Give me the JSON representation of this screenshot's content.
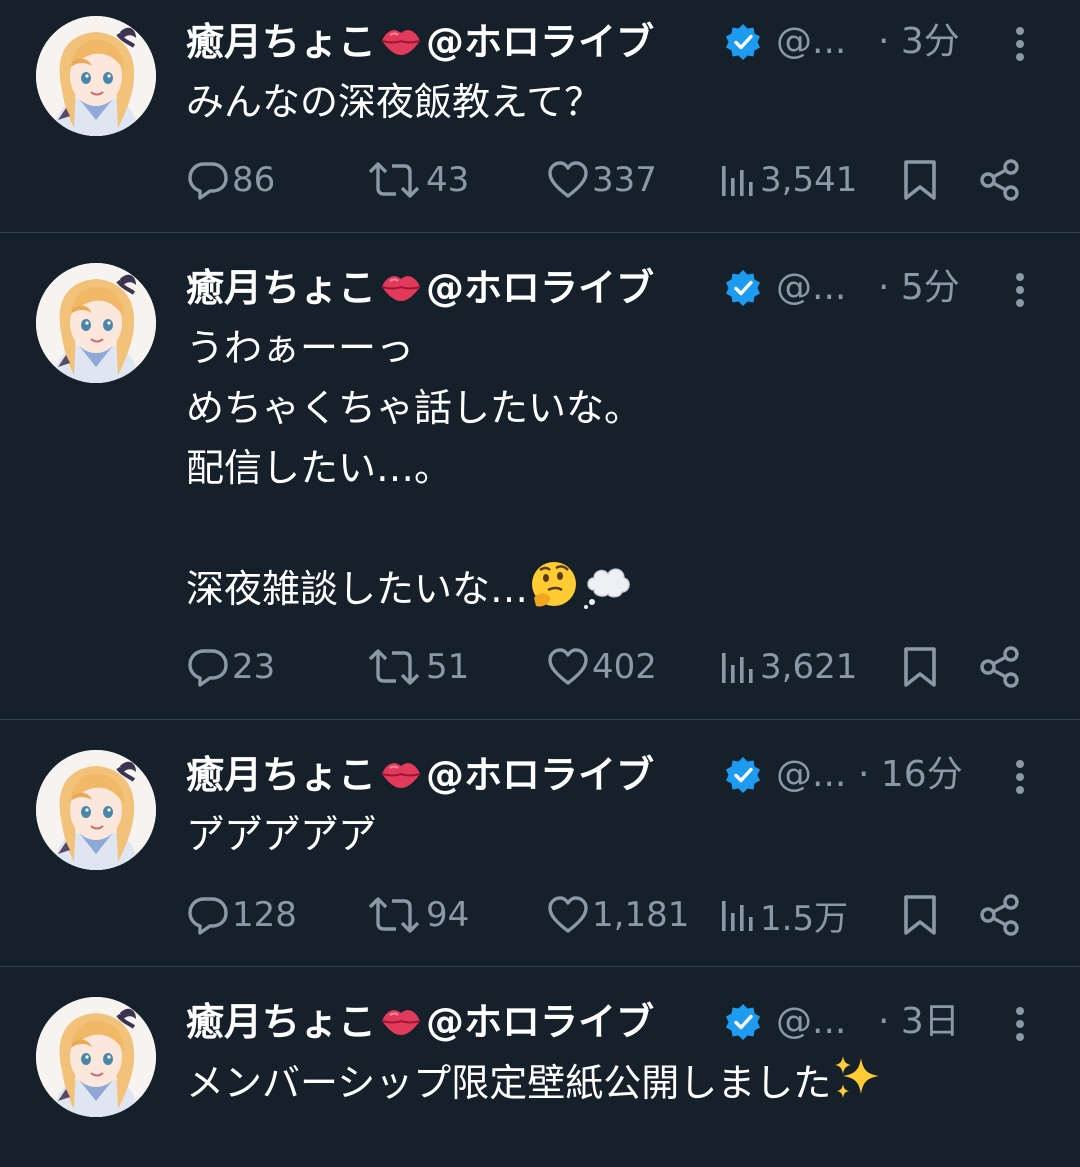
{
  "colors": {
    "background": "#15202b",
    "text": "#ffffff",
    "muted": "#8b98a5",
    "divider": "#38444d",
    "verified": "#1d9bf0"
  },
  "tweets": [
    {
      "name": "癒月ちょこ",
      "name_suffix": "@ホロライブ",
      "name_emoji": "lips-icon",
      "handle": "@...",
      "time": "· 3分",
      "text": "みんなの深夜飯教えて？",
      "emoji": [],
      "replies": "86",
      "retweets": "43",
      "likes": "337",
      "views": "3,541"
    },
    {
      "name": "癒月ちょこ",
      "name_suffix": "@ホロライブ",
      "name_emoji": "lips-icon",
      "handle": "@...",
      "time": "· 5分",
      "text": "うわぁーーっ\nめちゃくちゃ話したいな。\n配信したい…。\n\n深夜雑談したいな…",
      "emoji": [
        "thinking-face-icon",
        "thought-balloon-icon"
      ],
      "replies": "23",
      "retweets": "51",
      "likes": "402",
      "views": "3,621"
    },
    {
      "name": "癒月ちょこ",
      "name_suffix": "@ホロライブ",
      "name_emoji": "lips-icon",
      "handle": "@...",
      "time": "· 16分",
      "text": "ア゙ア゙ア゙ア゙ア゙",
      "emoji": [],
      "replies": "128",
      "retweets": "94",
      "likes": "1,181",
      "views": "1.5万"
    },
    {
      "name": "癒月ちょこ",
      "name_suffix": "@ホロライブ",
      "name_emoji": "lips-icon",
      "handle": "@...",
      "time": "· 3日",
      "text": "メンバーシップ限定壁紙公開しました",
      "emoji": [
        "sparkles-icon"
      ]
    }
  ]
}
